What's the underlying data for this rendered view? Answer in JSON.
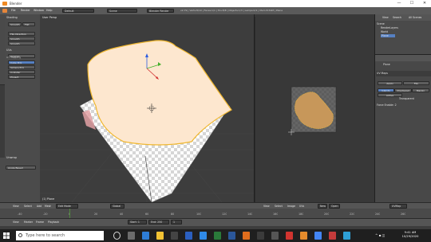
{
  "window": {
    "title": "Blender",
    "controls": [
      "—",
      "☐",
      "✕"
    ]
  },
  "info_header": {
    "menus": [
      "File",
      "Render",
      "Window",
      "Help"
    ],
    "layout": "Default",
    "scene": "Scene",
    "engine": "Blender Render",
    "stats": "v2.79 | Verts:8/10 | Faces:1/1 | Tris:8/8 | Objects:1/3 | Lamps:0/1 | Mem:8.59M | Plane"
  },
  "tool_shelf": {
    "sections": [
      {
        "title": "Shading",
        "buttons": [
          "Smooth",
          "Flat"
        ]
      },
      {
        "title": "UVs",
        "buttons": [
          "Unwrap"
        ]
      },
      {
        "title": "UV Mapping",
        "buttons": [
          "Cube Proj",
          "Sphere Proj",
          "Cylinder",
          "Project"
        ]
      }
    ],
    "transform_buttons": [
      "Flip Direction",
      "Smooth",
      "Smooth"
    ],
    "operator_title": "Unwrap",
    "operator_field": "Angle Based"
  },
  "viewport": {
    "label": "User Persp",
    "object_label": "(1) Plane",
    "header_menus": [
      "View",
      "Select",
      "Add",
      "Mesh"
    ],
    "mode": "Edit Mode",
    "pivot": "Global"
  },
  "uv_editor": {
    "header_menus": [
      "View",
      "Select",
      "Image",
      "UVs"
    ],
    "image_button": "New",
    "open_button": "Open",
    "sync_label": "UVMap"
  },
  "outliner": {
    "tabs": [
      "View",
      "Search",
      "All Scenes"
    ],
    "items": [
      "Scene",
      "RenderLayers",
      "World",
      "Plane"
    ]
  },
  "properties": {
    "object_name": "Plane",
    "panel": "UV Maps",
    "buttons": [
      "Apply",
      "Flip"
    ],
    "modes": [
      "Islands",
      "Checkered",
      "Margin"
    ],
    "options": [
      "Active",
      "Transparent"
    ],
    "extra": "Force Enable: 2"
  },
  "timeline": {
    "menus": [
      "View",
      "Marker",
      "Frame",
      "Playback"
    ],
    "start_label": "Start: 1",
    "end_label": "End: 250",
    "frame": "1",
    "ticks": [
      "-40",
      "-20",
      "0",
      "20",
      "40",
      "60",
      "80",
      "100",
      "120",
      "140",
      "160",
      "180",
      "200",
      "220",
      "240",
      "260"
    ]
  },
  "taskbar": {
    "search_placeholder": "Type here to search",
    "time": "9:41 AM",
    "date": "10/29/2020"
  },
  "colors": {
    "accent": "#5680c2",
    "face_fill": "#fde7cf",
    "face_outline": "#f0b72f",
    "uv_face": "#c7975a"
  }
}
